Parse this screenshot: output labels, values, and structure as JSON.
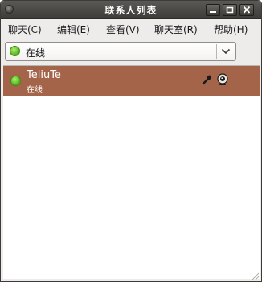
{
  "window": {
    "title": "联系人列表"
  },
  "menu": {
    "items": [
      {
        "label": "聊天(C)"
      },
      {
        "label": "编辑(E)"
      },
      {
        "label": "查看(V)"
      },
      {
        "label": "聊天室(R)"
      },
      {
        "label": "帮助(H)"
      }
    ]
  },
  "status_combo": {
    "value": "在线",
    "status_icon": "green-online-dot"
  },
  "contacts": [
    {
      "name": "TeliuTe",
      "status": "在线",
      "status_icon": "green-online-dot",
      "capabilities": [
        "microphone-icon",
        "webcam-icon"
      ],
      "selected": true
    }
  ],
  "colors": {
    "selection": "#a4644a",
    "online": "#4fb11c",
    "titlebar": "#3d3c38"
  }
}
